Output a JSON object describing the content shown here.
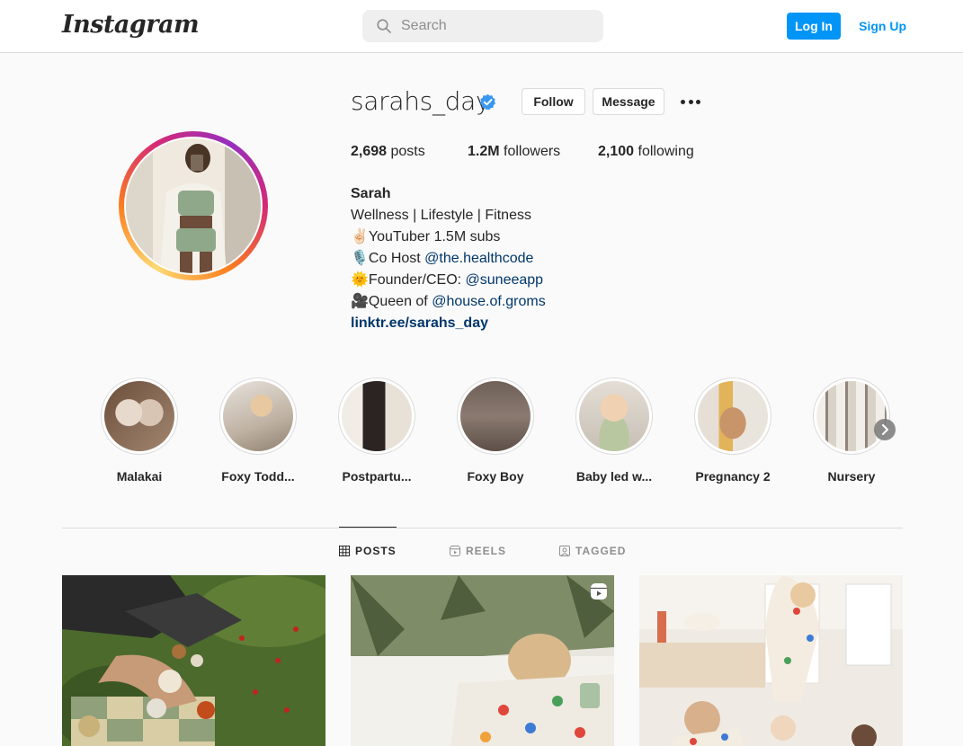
{
  "header": {
    "logo": "Instagram",
    "search_placeholder": "Search",
    "login_label": "Log In",
    "signup_label": "Sign Up"
  },
  "profile": {
    "username": "sarahs_day",
    "follow_label": "Follow",
    "message_label": "Message",
    "stats": {
      "posts_count": "2,698",
      "posts_label": "posts",
      "followers_count": "1.2M",
      "followers_label": "followers",
      "following_count": "2,100",
      "following_label": "following"
    },
    "bio": {
      "name": "Sarah",
      "line1": "Wellness | Lifestyle | Fitness",
      "line2": "✌🏻YouTuber 1.5M subs",
      "line3_prefix": "🎙️Co Host ",
      "line3_mention": "@the.healthcode",
      "line4_prefix": "🌞Founder/CEO: ",
      "line4_mention": "@suneeapp",
      "line5_prefix": "🎥Queen of ",
      "line5_mention": "@house.of.groms",
      "link": "linktr.ee/sarahs_day"
    }
  },
  "highlights": [
    {
      "label": "Malakai",
      "color": "#8a6f5a"
    },
    {
      "label": "Foxy Todd...",
      "color": "#c9b8a8"
    },
    {
      "label": "Postpartu...",
      "color": "#b59f8b"
    },
    {
      "label": "Foxy Boy",
      "color": "#7d6a5c"
    },
    {
      "label": "Baby led w...",
      "color": "#9aa58c"
    },
    {
      "label": "Pregnancy 2",
      "color": "#c8a27a"
    },
    {
      "label": "Nursery",
      "color": "#a9a096"
    }
  ],
  "tabs": [
    {
      "label": "POSTS",
      "active": true
    },
    {
      "label": "REELS",
      "active": false
    },
    {
      "label": "TAGGED",
      "active": false
    }
  ],
  "colors": {
    "accent": "#0095f6",
    "link": "#00376b",
    "verified": "#3897f0"
  }
}
